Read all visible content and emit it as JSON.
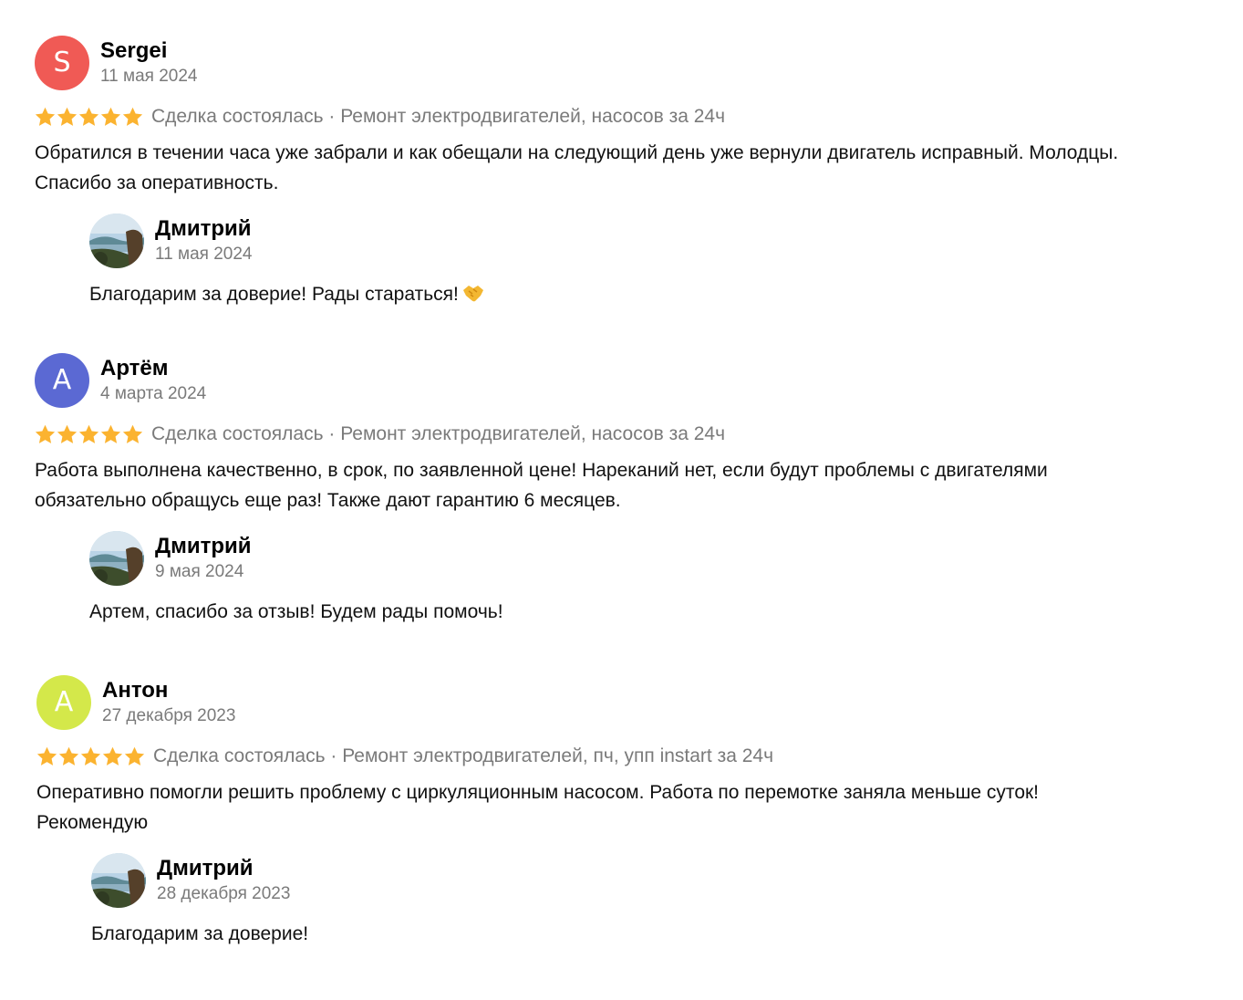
{
  "colors": {
    "star": "#fbb330",
    "avatar_s": "#f05a55",
    "avatar_a1": "#5b69d3",
    "avatar_a2": "#d4e84a",
    "meta_gray": "#7a7a7a"
  },
  "reviews": [
    {
      "initial": "S",
      "author": "Sergei",
      "date": "11 мая 2024",
      "rating": 5,
      "meta": "Сделка состоялась · Ремонт электродвигателей, насосов за 24ч",
      "text_line1": "Обратился в течении часа уже забрали и как обещали на следующий день уже вернули двигатель исправный. Молодцы.",
      "text_line2": "Спасибо за оперативность.",
      "reply": {
        "author": "Дмитрий",
        "date": "11 мая 2024",
        "text": "Благодарим за доверие! Рады стараться!",
        "emoji_icon": "handshake-icon"
      }
    },
    {
      "initial": "А",
      "author": "Артём",
      "date": "4 марта 2024",
      "rating": 5,
      "meta": "Сделка состоялась · Ремонт электродвигателей, насосов за 24ч",
      "text_line1": "Работа выполнена качественно, в срок, по заявленной цене! Нареканий нет, если будут проблемы с двигателями",
      "text_line2": "обязательно обращусь еще раз! Также дают гарантию 6 месяцев.",
      "reply": {
        "author": "Дмитрий",
        "date": "9 мая 2024",
        "text": "Артем, спасибо за отзыв! Будем рады помочь!"
      }
    },
    {
      "initial": "А",
      "author": "Антон",
      "date": "27 декабря 2023",
      "rating": 5,
      "meta": "Сделка состоялась · Ремонт электродвигателей, пч, упп instart за 24ч",
      "text_line1": "Оперативно помогли решить проблему с циркуляционным насосом. Работа по перемотке заняла меньше суток!",
      "text_line2": "Рекомендую",
      "reply": {
        "author": "Дмитрий",
        "date": "28 декабря 2023",
        "text": "Благодарим за доверие!"
      }
    }
  ]
}
